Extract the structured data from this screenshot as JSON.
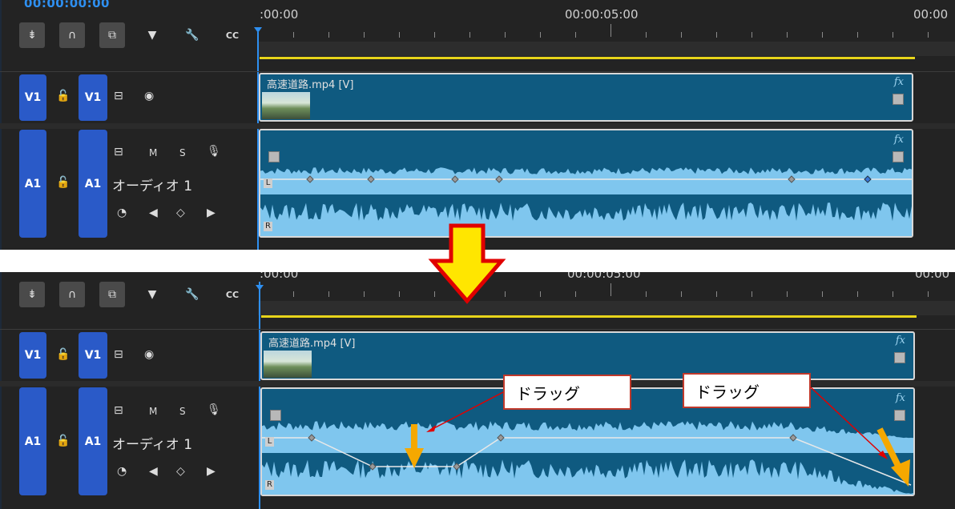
{
  "timecode": "00:00:00:00",
  "toolbar": {
    "tools": [
      {
        "name": "insert-edit",
        "glyph": "⇟"
      },
      {
        "name": "snap",
        "glyph": "∩"
      },
      {
        "name": "linked-selection",
        "glyph": "⧉"
      },
      {
        "name": "marker",
        "glyph": "▼"
      },
      {
        "name": "wrench",
        "glyph": "🔧"
      },
      {
        "name": "captions",
        "glyph": "CC"
      }
    ]
  },
  "ruler": {
    "labels": [
      ":00:00",
      "00:00:05:00",
      "00:00"
    ]
  },
  "tracks": {
    "video": {
      "source_label": "V1",
      "target_label": "V1",
      "clip_title": "高速道路.mp4 [V]"
    },
    "audio": {
      "source_label": "A1",
      "target_label": "A1",
      "name": "オーディオ 1",
      "mute": "M",
      "solo": "S",
      "l_label": "L",
      "r_label": "R"
    }
  },
  "fx_label": "fx",
  "callouts": {
    "left": "ドラッグ",
    "right": "ドラッグ"
  },
  "colors": {
    "accent_blue": "#2a5ac8",
    "clip_blue": "#0f5a80",
    "waveform": "#7fc6ee",
    "yellow": "#e8d51a",
    "arrow_red": "#e00000",
    "arrow_orange": "#f5a800"
  }
}
